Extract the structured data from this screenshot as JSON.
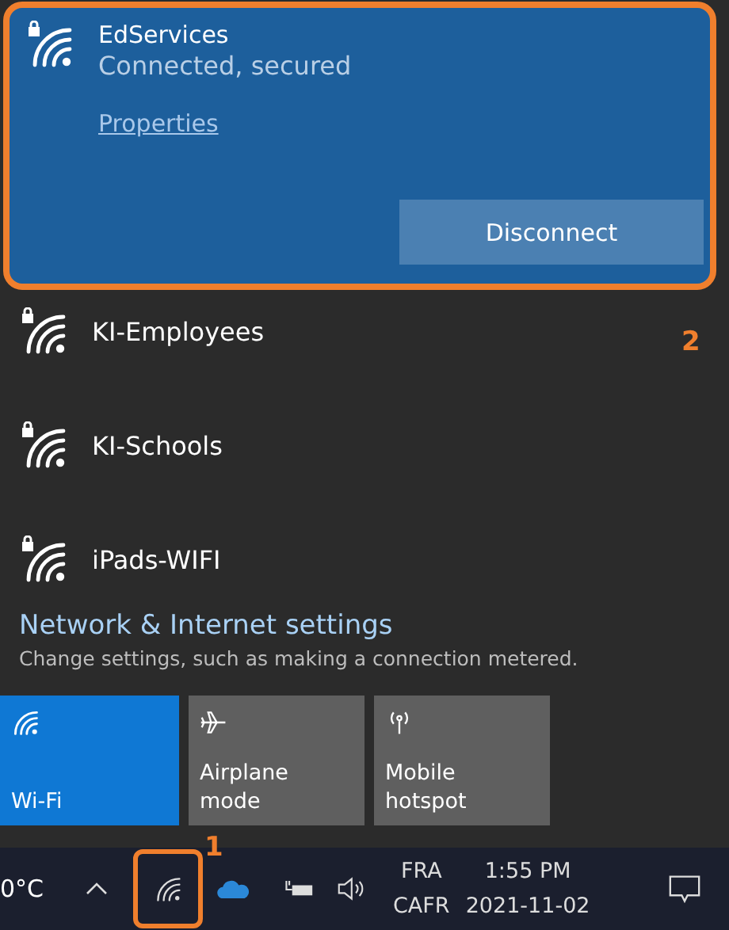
{
  "connected": {
    "name": "EdServices",
    "status": "Connected, secured",
    "properties_link": "Properties",
    "button": "Disconnect",
    "highlighted": true,
    "callout": "2"
  },
  "networks": [
    {
      "name": "KI-Employees"
    },
    {
      "name": "KI-Schools"
    },
    {
      "name": "iPads-WIFI"
    }
  ],
  "settings": {
    "link": "Network & Internet settings",
    "description": "Change settings, such as making a connection metered."
  },
  "tiles": [
    {
      "kind": "wifi",
      "label": "Wi-Fi",
      "on": true
    },
    {
      "kind": "airplane",
      "label": "Airplane mode",
      "on": false
    },
    {
      "kind": "hotspot",
      "label": "Mobile\nhotspot",
      "on": false
    }
  ],
  "taskbar": {
    "temperature": "0°C",
    "wifi_highlighted": true,
    "callout": "1",
    "language_top": "FRA",
    "language_bottom": "CAFR",
    "time": "1:55 PM",
    "date": "2021-11-02"
  }
}
